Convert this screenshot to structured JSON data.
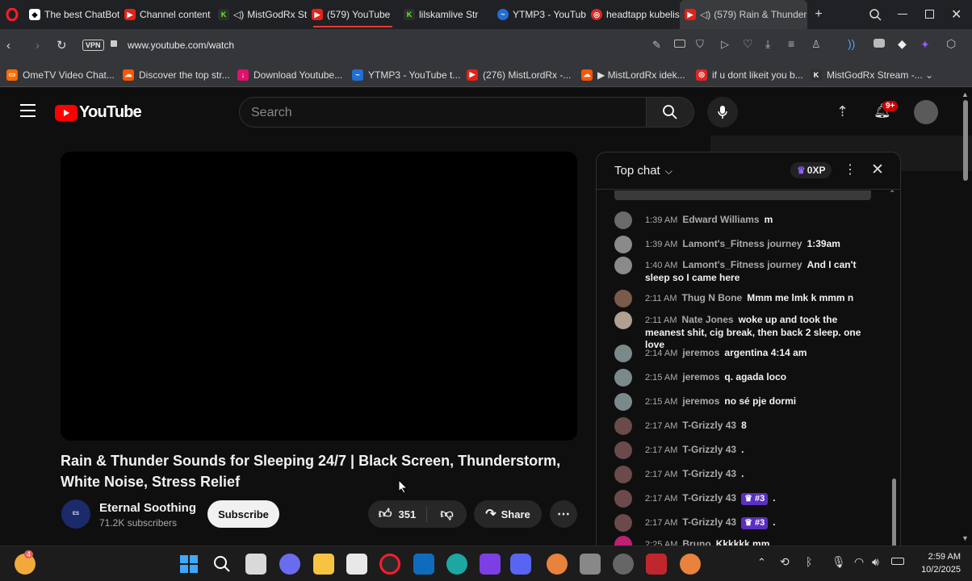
{
  "browser": {
    "tabs": [
      {
        "label": "The best ChatBot",
        "icon": "chatbot-icon"
      },
      {
        "label": "Channel content -",
        "icon": "youtube-icon"
      },
      {
        "label": "MistGodRx St",
        "icon": "kick-icon",
        "audio": true
      },
      {
        "label": "(579) YouTube",
        "icon": "youtube-icon"
      },
      {
        "label": "lilskamlive Str",
        "icon": "kick-icon"
      },
      {
        "label": "YTMP3 - YouTube",
        "icon": "ytmp3-icon"
      },
      {
        "label": "headtapp kubelis",
        "icon": "headtapp-icon"
      },
      {
        "label": "(579) Rain & Thunder",
        "icon": "youtube-icon",
        "audio": true
      }
    ],
    "new_tab": "+",
    "url": "www.youtube.com/watch",
    "vpn": "VPN",
    "bookmarks": [
      {
        "label": "OmeTV Video Chat..."
      },
      {
        "label": "Discover the top str..."
      },
      {
        "label": "Download Youtube..."
      },
      {
        "label": "YTMP3 - YouTube t..."
      },
      {
        "label": "(276) MistLordRx -..."
      },
      {
        "label": "▶ MistLordRx idek..."
      },
      {
        "label": "if u dont likeit you b..."
      },
      {
        "label": "MistGodRx Stream -..."
      }
    ]
  },
  "youtube": {
    "logo_text": "YouTube",
    "search_placeholder": "Search",
    "notifications_count": "9+"
  },
  "video": {
    "title": "Rain & Thunder Sounds for Sleeping 24/7 | Black Screen, Thunderstorm, White Noise, Stress Relief",
    "channel": "Eternal Soothing",
    "subscribers": "71.2K subscribers",
    "subscribe_label": "Subscribe",
    "likes": "351",
    "share_label": "Share"
  },
  "chat": {
    "mode": "Top chat",
    "xp": "0XP",
    "messages": [
      {
        "time": "1:39 AM",
        "author": "Edward Williams",
        "text": "m"
      },
      {
        "time": "1:39 AM",
        "author": "Lamont's_Fitness journey",
        "text": "1:39am"
      },
      {
        "time": "1:40 AM",
        "author": "Lamont's_Fitness journey",
        "text": "And I can't sleep so I came here"
      },
      {
        "time": "2:11 AM",
        "author": "Thug N Bone",
        "text": "Mmm me lmk k mmm n"
      },
      {
        "time": "2:11 AM",
        "author": "Nate Jones",
        "text": "woke up and took the meanest shit, cig break, then back 2 sleep. one love"
      },
      {
        "time": "2:14 AM",
        "author": "jeremos",
        "text": "argentina 4:14 am"
      },
      {
        "time": "2:15 AM",
        "author": "jeremos",
        "text": "q. agada loco"
      },
      {
        "time": "2:15 AM",
        "author": "jeremos",
        "text": "no sé pje dormi"
      },
      {
        "time": "2:17 AM",
        "author": "T-Grizzly 43",
        "text": "8"
      },
      {
        "time": "2:17 AM",
        "author": "T-Grizzly 43",
        "text": "."
      },
      {
        "time": "2:17 AM",
        "author": "T-Grizzly 43",
        "text": "."
      },
      {
        "time": "2:17 AM",
        "author": "T-Grizzly 43",
        "badge": "#3",
        "text": "."
      },
      {
        "time": "2:17 AM",
        "author": "T-Grizzly 43",
        "badge": "#3",
        "text": "."
      },
      {
        "time": "2:25 AM",
        "author": "Bruno",
        "text": "Kkkkkk mm"
      }
    ]
  },
  "taskbar": {
    "time": "2:59 AM",
    "date": "10/2/2025",
    "widget_badge": "4"
  }
}
